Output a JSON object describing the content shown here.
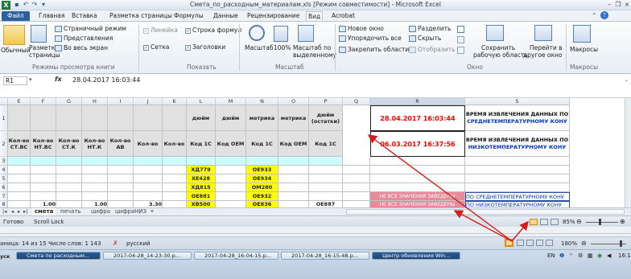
{
  "window": {
    "title": "Смета_по_расходным_материалам.xls  [Режим совместимости]  -  Microsoft Excel"
  },
  "tabs": [
    "Файл",
    "Главная",
    "Вставка",
    "Разметка страницы",
    "Формулы",
    "Данные",
    "Рецензирование",
    "Вид",
    "Acrobat"
  ],
  "active_tab": "Вид",
  "ribbon": {
    "normal": "Обычный",
    "page_layout_1": "Разметка",
    "page_layout_2": "страницы",
    "page_mode": "Страничный режим",
    "views": "Представления",
    "fullscreen": "Во весь экран",
    "group_views": "Режимы просмотра книги",
    "ruler": "Линейка",
    "formula_bar": "Строка формул",
    "grid": "Сетка",
    "headings": "Заголовки",
    "group_show": "Показать",
    "zoom": "Масштаб",
    "zoom100": "100%",
    "zoom_sel_1": "Масштаб по",
    "zoom_sel_2": "выделенному",
    "group_zoom": "Масштаб",
    "new_window": "Новое окно",
    "arrange_all": "Упорядочить все",
    "freeze": "Закрепить области",
    "split": "Разделить",
    "hide": "Скрыть",
    "unhide": "Отобразить",
    "save_ws_1": "Сохранить",
    "save_ws_2": "рабочую область",
    "switch_1": "Перейти в",
    "switch_2": "другое окно",
    "group_window": "Окно",
    "macros": "Макросы",
    "group_macros": "Макросы"
  },
  "formula": {
    "cell_ref": "R1",
    "fx": "fx",
    "value": "28.04.2017 16:03:44"
  },
  "grid": {
    "columns": [
      "E",
      "F",
      "G",
      "H",
      "I",
      "J",
      "K",
      "L",
      "M",
      "N",
      "O",
      "P",
      "Q",
      "R",
      "S"
    ],
    "rows": [
      "1",
      "2",
      "3",
      "4",
      "5",
      "6",
      "7",
      "8"
    ],
    "row1": [
      "дюйм",
      "дюйм",
      "метрика",
      "метрика",
      "дюйм (остатки)"
    ],
    "row2": [
      "Кол-во СТ.ВС",
      "Кол-во НТ.ВС",
      "Кол-во СТ.К",
      "Кол-во НТ.К",
      "Кол-во АВ",
      "Кол-во",
      "Кол-во",
      "Код 1С",
      "Код OEM",
      "Код 1С",
      "Код OEM",
      "Код 1С"
    ],
    "codes_L": [
      "ХД779",
      "ХЕ428",
      "ХД815",
      "ОЕ881",
      "ХВ500"
    ],
    "codes_N": [
      "ОЕ933",
      "ОЕ934",
      "ОМ280",
      "ОЕ932",
      "ОЕ836"
    ],
    "row8": {
      "F": "1.00",
      "H": "1.00",
      "J": "3.30",
      "P": "ОЕ887"
    },
    "R1": "28.04.2017 16:03:44",
    "R2": "06.03.2017 16:37:56",
    "S1_a": "ВРЕМЯ ИЗВЛЕЧЕНИЯ ДАННЫХ ПО",
    "S1_b": "СРЕДНЕТЕМПЕРАТУРНОМУ КОНУ",
    "S2_a": "ВРЕМЯ ИЗВЛЕЧЕНИЯ ДАННЫХ ПО",
    "S2_b": "НИЗКОТЕМПЕРАТУРНОМУ КОНУ",
    "R7": "НЕ ВСЕ ЗНАЧЕНИЯ ЗАВЕДЕНЫ",
    "R8": "НЕ ВСЕ ЗНАЧЕНИЯ ЗАВЕДЕНЫ",
    "S7": "ПО СРЕДНЕТЕМПЕРАТУРНОМУ КОНУ",
    "S8": "ПО НИЗКОТЕМПЕРАТУРНОМУ КОНУ"
  },
  "sheets": [
    "смета",
    "печать",
    "цифра",
    "цифраНИЗ"
  ],
  "status": {
    "ready": "Готово",
    "scroll_lock": "Scroll Lock",
    "zoom": "85%"
  },
  "word_status": {
    "page": "аница: 14 из 15",
    "words": "Число слов: 1 143",
    "lang": "русский",
    "zoom": "180%"
  },
  "taskbar": {
    "items": [
      "Смета по расходным...",
      "2017-04-28_14-23-30.p...",
      "2017-04-28_16-04-15.p...",
      "2017-04-28_16-15-48.p...",
      "Центр обновления Win..."
    ],
    "lang": "EN",
    "time": "16:1"
  },
  "colors": {
    "accent": "#2c5f9e",
    "yellow": "#ffff00",
    "cyan": "#ccffff",
    "pink": "#f9c6d0",
    "red_text": "#ff0000",
    "blue_text": "#0033cc",
    "arrow": "#d81b1b"
  }
}
